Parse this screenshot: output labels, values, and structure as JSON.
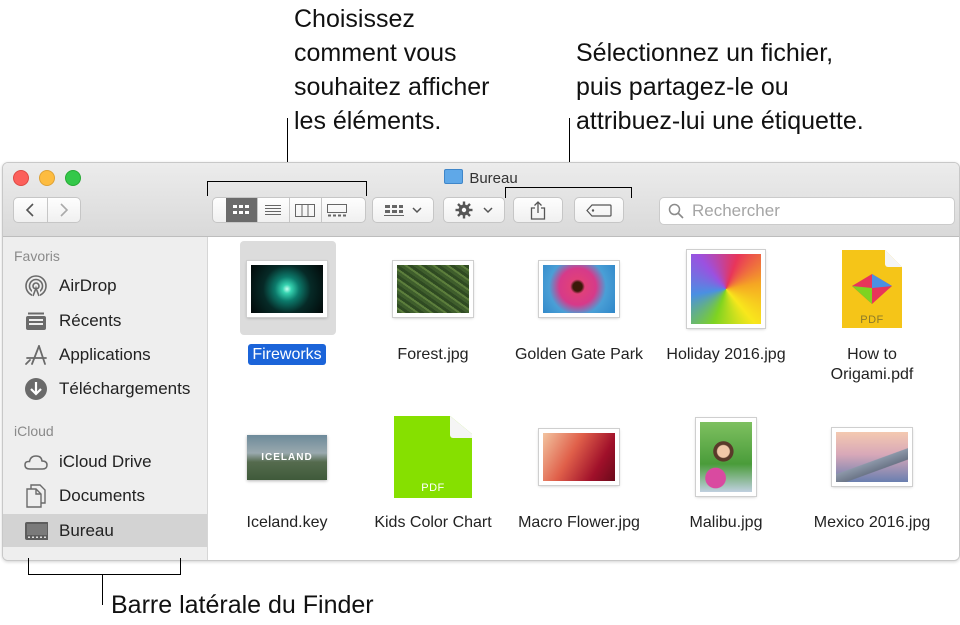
{
  "callouts": {
    "view_options": "Choisissez\ncomment vous\nsouhaitez afficher\nles éléments.",
    "share_tag": "Sélectionnez un fichier,\npuis partagez-le ou\nattribuez-lui une étiquette.",
    "sidebar": "Barre latérale du Finder"
  },
  "window": {
    "title": "Bureau",
    "search": {
      "placeholder": "Rechercher",
      "value": ""
    }
  },
  "sidebar": {
    "sections": [
      {
        "header": "Favoris",
        "items": [
          {
            "label": "AirDrop",
            "icon": "airdrop-icon"
          },
          {
            "label": "Récents",
            "icon": "recents-icon"
          },
          {
            "label": "Applications",
            "icon": "applications-icon"
          },
          {
            "label": "Téléchargements",
            "icon": "downloads-icon"
          }
        ]
      },
      {
        "header": "iCloud",
        "items": [
          {
            "label": "iCloud Drive",
            "icon": "cloud-icon"
          },
          {
            "label": "Documents",
            "icon": "documents-icon"
          },
          {
            "label": "Bureau",
            "icon": "desktop-icon",
            "selected": true
          }
        ]
      }
    ]
  },
  "files": [
    {
      "name": "Fireworks",
      "selected": true
    },
    {
      "name": "Forest.jpg"
    },
    {
      "name": "Golden Gate Park"
    },
    {
      "name": "Holiday 2016.jpg"
    },
    {
      "name": "How to\nOrigami.pdf",
      "pdf_label": "PDF"
    },
    {
      "name": "Iceland.key",
      "thumb_text": "ICELAND"
    },
    {
      "name": "Kids Color Chart",
      "pdf_label": "PDF"
    },
    {
      "name": "Macro Flower.jpg"
    },
    {
      "name": "Malibu.jpg"
    },
    {
      "name": "Mexico 2016.jpg"
    }
  ],
  "colors": {
    "selection": "#1b64d9",
    "traffic_close": "#fc605b",
    "traffic_min": "#fdbc40",
    "traffic_max": "#34c84a"
  }
}
